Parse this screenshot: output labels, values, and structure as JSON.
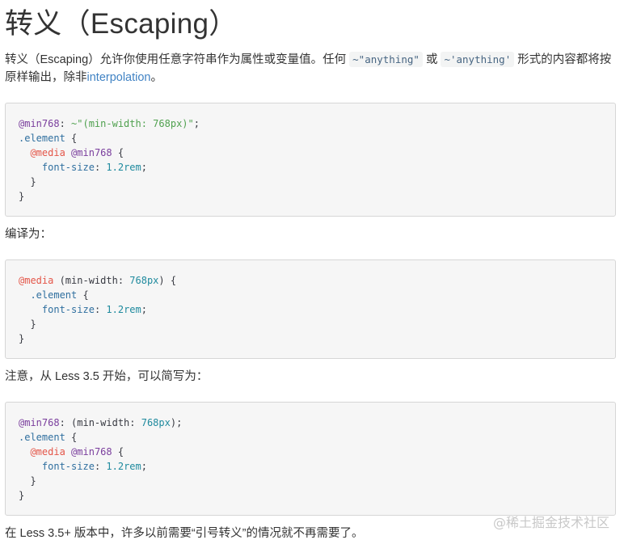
{
  "heading": "转义（Escaping）",
  "para1": {
    "before": "转义（Escaping）允许你使用任意字符串作为属性或变量值。任何",
    "code1": "~\"anything\"",
    "mid": "或",
    "code2": "~'anything'",
    "after": "形式的内容都将按原样输出，除非",
    "link": "interpolation",
    "end": "。"
  },
  "para2": "编译为：",
  "para3": "注意，从 Less 3.5 开始，可以简写为：",
  "para4": "在 Less 3.5+ 版本中，许多以前需要“引号转义”的情况就不再需要了。",
  "code_block_1": {
    "l1_var": "@min768",
    "l1_colon": ": ",
    "l1_str": "~\"(min-width: 768px)\"",
    "l1_end": ";",
    "l2_sel": ".element",
    "l2_brace": " {",
    "l3_indent": "  ",
    "l3_at": "@media",
    "l3_sp": " ",
    "l3_var": "@min768",
    "l3_brace": " {",
    "l4_indent": "    ",
    "l4_prop": "font-size",
    "l4_colon": ": ",
    "l4_num": "1.2rem",
    "l4_end": ";",
    "l5": "  }",
    "l6": "}"
  },
  "code_block_2": {
    "l1_at": "@media",
    "l1_a": " (min-width: ",
    "l1_num": "768px",
    "l1_b": ") {",
    "l2_indent": "  ",
    "l2_sel": ".element",
    "l2_brace": " {",
    "l3_indent": "    ",
    "l3_prop": "font-size",
    "l3_colon": ": ",
    "l3_num": "1.2rem",
    "l3_end": ";",
    "l4": "  }",
    "l5": "}"
  },
  "code_block_3": {
    "l1_var": "@min768",
    "l1_a": ": (min-width: ",
    "l1_num": "768px",
    "l1_b": ");",
    "l2_sel": ".element",
    "l2_brace": " {",
    "l3_indent": "  ",
    "l3_at": "@media",
    "l3_sp": " ",
    "l3_var": "@min768",
    "l3_brace": " {",
    "l4_indent": "    ",
    "l4_prop": "font-size",
    "l4_colon": ": ",
    "l4_num": "1.2rem",
    "l4_end": ";",
    "l5": "  }",
    "l6": "}"
  },
  "watermark": "@稀土掘金技术社区",
  "colors": {
    "link": "#4183c4",
    "variable": "#7a3e9d",
    "at_rule": "#e45649",
    "string": "#50a14f",
    "number": "#1f8a9e"
  }
}
